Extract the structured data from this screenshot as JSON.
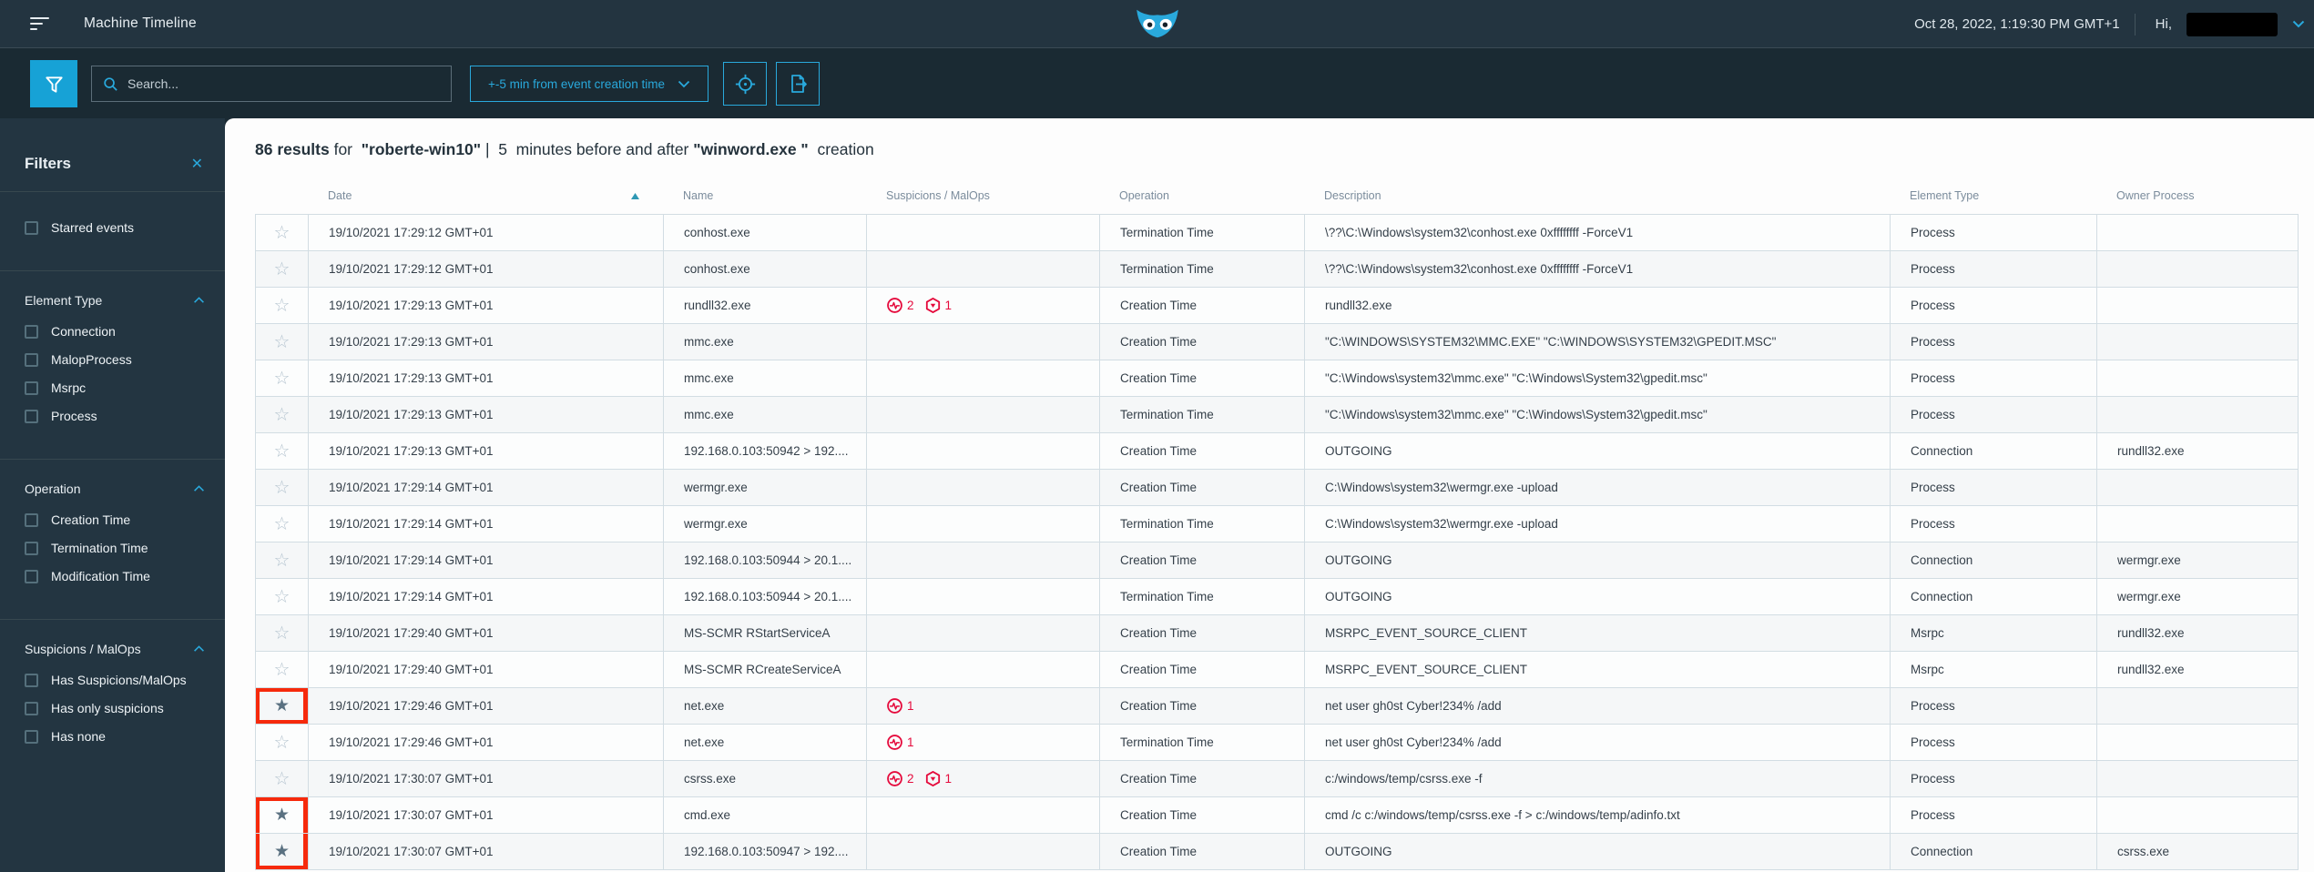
{
  "header": {
    "title": "Machine Timeline",
    "datetime": "Oct 28, 2022, 1:19:30 PM GMT+1",
    "greeting": "Hi,",
    "logo": "owl-logo"
  },
  "toolbar": {
    "search_placeholder": "Search...",
    "time_range_label": "+-5 min from event creation time",
    "icons": [
      "filter-funnel-icon",
      "search-icon",
      "crosshair-icon",
      "export-icon"
    ]
  },
  "results_header": {
    "segments": [
      {
        "t": "86 results",
        "b": true
      },
      {
        "t": " for  ",
        "b": false
      },
      {
        "t": "\"roberte-win10\"",
        "b": true
      },
      {
        "t": " |  5  minutes before and after ",
        "b": false
      },
      {
        "t": "\"winword.exe \"",
        "b": true
      },
      {
        "t": "  creation",
        "b": false
      }
    ]
  },
  "filters": {
    "title": "Filters",
    "sections": [
      {
        "title": null,
        "items": [
          "Starred events"
        ]
      },
      {
        "title": "Element Type",
        "items": [
          "Connection",
          "MalopProcess",
          "Msrpc",
          "Process"
        ]
      },
      {
        "title": "Operation",
        "items": [
          "Creation Time",
          "Termination Time",
          "Modification Time"
        ]
      },
      {
        "title": "Suspicions / MalOps",
        "items": [
          "Has Suspicions/MalOps",
          "Has only suspicions",
          "Has none"
        ]
      }
    ]
  },
  "table": {
    "columns": [
      "Date",
      "Name",
      "Suspicions / MalOps",
      "Operation",
      "Description",
      "Element Type",
      "Owner Process"
    ],
    "sort": {
      "column": "Date",
      "direction": "asc"
    },
    "rows": [
      {
        "starred": false,
        "redbox": "none",
        "date": "19/10/2021 17:29:12 GMT+01",
        "name": "conhost.exe",
        "susp": null,
        "malops": null,
        "op": "Termination Time",
        "desc": "\\??\\C:\\Windows\\system32\\conhost.exe 0xffffffff -ForceV1",
        "type": "Process",
        "owner": ""
      },
      {
        "starred": false,
        "redbox": "none",
        "date": "19/10/2021 17:29:12 GMT+01",
        "name": "conhost.exe",
        "susp": null,
        "malops": null,
        "op": "Termination Time",
        "desc": "\\??\\C:\\Windows\\system32\\conhost.exe 0xffffffff -ForceV1",
        "type": "Process",
        "owner": ""
      },
      {
        "starred": false,
        "redbox": "none",
        "date": "19/10/2021 17:29:13 GMT+01",
        "name": "rundll32.exe",
        "susp": 2,
        "malops": 1,
        "op": "Creation Time",
        "desc": "rundll32.exe",
        "type": "Process",
        "owner": ""
      },
      {
        "starred": false,
        "redbox": "none",
        "date": "19/10/2021 17:29:13 GMT+01",
        "name": "mmc.exe",
        "susp": null,
        "malops": null,
        "op": "Creation Time",
        "desc": "\"C:\\WINDOWS\\SYSTEM32\\MMC.EXE\" \"C:\\WINDOWS\\SYSTEM32\\GPEDIT.MSC\"",
        "type": "Process",
        "owner": ""
      },
      {
        "starred": false,
        "redbox": "none",
        "date": "19/10/2021 17:29:13 GMT+01",
        "name": "mmc.exe",
        "susp": null,
        "malops": null,
        "op": "Creation Time",
        "desc": "\"C:\\Windows\\system32\\mmc.exe\" \"C:\\Windows\\System32\\gpedit.msc\"",
        "type": "Process",
        "owner": ""
      },
      {
        "starred": false,
        "redbox": "none",
        "date": "19/10/2021 17:29:13 GMT+01",
        "name": "mmc.exe",
        "susp": null,
        "malops": null,
        "op": "Termination Time",
        "desc": "\"C:\\Windows\\system32\\mmc.exe\" \"C:\\Windows\\System32\\gpedit.msc\"",
        "type": "Process",
        "owner": ""
      },
      {
        "starred": false,
        "redbox": "none",
        "date": "19/10/2021 17:29:13 GMT+01",
        "name": "192.168.0.103:50942 > 192....",
        "susp": null,
        "malops": null,
        "op": "Creation Time",
        "desc": "OUTGOING",
        "type": "Connection",
        "owner": "rundll32.exe"
      },
      {
        "starred": false,
        "redbox": "none",
        "date": "19/10/2021 17:29:14 GMT+01",
        "name": "wermgr.exe",
        "susp": null,
        "malops": null,
        "op": "Creation Time",
        "desc": "C:\\Windows\\system32\\wermgr.exe -upload",
        "type": "Process",
        "owner": ""
      },
      {
        "starred": false,
        "redbox": "none",
        "date": "19/10/2021 17:29:14 GMT+01",
        "name": "wermgr.exe",
        "susp": null,
        "malops": null,
        "op": "Termination Time",
        "desc": "C:\\Windows\\system32\\wermgr.exe -upload",
        "type": "Process",
        "owner": ""
      },
      {
        "starred": false,
        "redbox": "none",
        "date": "19/10/2021 17:29:14 GMT+01",
        "name": "192.168.0.103:50944 > 20.1....",
        "susp": null,
        "malops": null,
        "op": "Creation Time",
        "desc": "OUTGOING",
        "type": "Connection",
        "owner": "wermgr.exe"
      },
      {
        "starred": false,
        "redbox": "none",
        "date": "19/10/2021 17:29:14 GMT+01",
        "name": "192.168.0.103:50944 > 20.1....",
        "susp": null,
        "malops": null,
        "op": "Termination Time",
        "desc": "OUTGOING",
        "type": "Connection",
        "owner": "wermgr.exe"
      },
      {
        "starred": false,
        "redbox": "none",
        "date": "19/10/2021 17:29:40 GMT+01",
        "name": "MS-SCMR RStartServiceA",
        "susp": null,
        "malops": null,
        "op": "Creation Time",
        "desc": "MSRPC_EVENT_SOURCE_CLIENT",
        "type": "Msrpc",
        "owner": "rundll32.exe"
      },
      {
        "starred": false,
        "redbox": "none",
        "date": "19/10/2021 17:29:40 GMT+01",
        "name": "MS-SCMR RCreateServiceA",
        "susp": null,
        "malops": null,
        "op": "Creation Time",
        "desc": "MSRPC_EVENT_SOURCE_CLIENT",
        "type": "Msrpc",
        "owner": "rundll32.exe"
      },
      {
        "starred": true,
        "redbox": "full",
        "date": "19/10/2021 17:29:46 GMT+01",
        "name": "net.exe",
        "susp": 1,
        "malops": null,
        "op": "Creation Time",
        "desc": "net user gh0st Cyber!234% /add",
        "type": "Process",
        "owner": ""
      },
      {
        "starred": false,
        "redbox": "none",
        "date": "19/10/2021 17:29:46 GMT+01",
        "name": "net.exe",
        "susp": 1,
        "malops": null,
        "op": "Termination Time",
        "desc": "net user gh0st Cyber!234% /add",
        "type": "Process",
        "owner": ""
      },
      {
        "starred": false,
        "redbox": "none",
        "date": "19/10/2021 17:30:07 GMT+01",
        "name": "csrss.exe",
        "susp": 2,
        "malops": 1,
        "op": "Creation Time",
        "desc": "c:/windows/temp/csrss.exe -f",
        "type": "Process",
        "owner": ""
      },
      {
        "starred": true,
        "redbox": "top",
        "date": "19/10/2021 17:30:07 GMT+01",
        "name": "cmd.exe",
        "susp": null,
        "malops": null,
        "op": "Creation Time",
        "desc": "cmd /c c:/windows/temp/csrss.exe -f > c:/windows/temp/adinfo.txt",
        "type": "Process",
        "owner": ""
      },
      {
        "starred": true,
        "redbox": "bottom",
        "date": "19/10/2021 17:30:07 GMT+01",
        "name": "192.168.0.103:50947 > 192....",
        "susp": null,
        "malops": null,
        "op": "Creation Time",
        "desc": "OUTGOING",
        "type": "Connection",
        "owner": "csrss.exe"
      }
    ]
  },
  "colors": {
    "accent": "#29a9dc",
    "alert_red": "#e50a3c",
    "highlight_red": "#f62a0c",
    "topbar": "#233440",
    "sidebar": "#233541"
  }
}
